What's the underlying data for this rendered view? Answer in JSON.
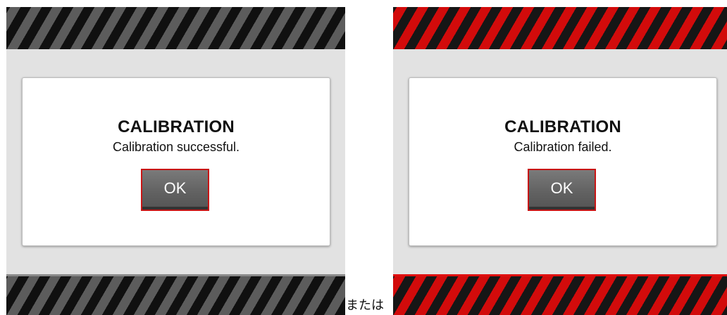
{
  "screens": [
    {
      "id": "success",
      "stripe_colors": {
        "dark": "#101010",
        "light": "#5c5c5c"
      },
      "dialog": {
        "title": "CALIBRATION",
        "message": "Calibration successful.",
        "ok_label": "OK"
      }
    },
    {
      "id": "failure",
      "stripe_colors": {
        "dark": "#161616",
        "light": "#d20b0b"
      },
      "dialog": {
        "title": "CALIBRATION",
        "message": "Calibration failed.",
        "ok_label": "OK"
      }
    }
  ],
  "separator_text": "または",
  "colors": {
    "panel_background": "#e2e2e2",
    "dialog_background": "#ffffff",
    "button_border": "#c81515",
    "button_fill": "#626262"
  }
}
